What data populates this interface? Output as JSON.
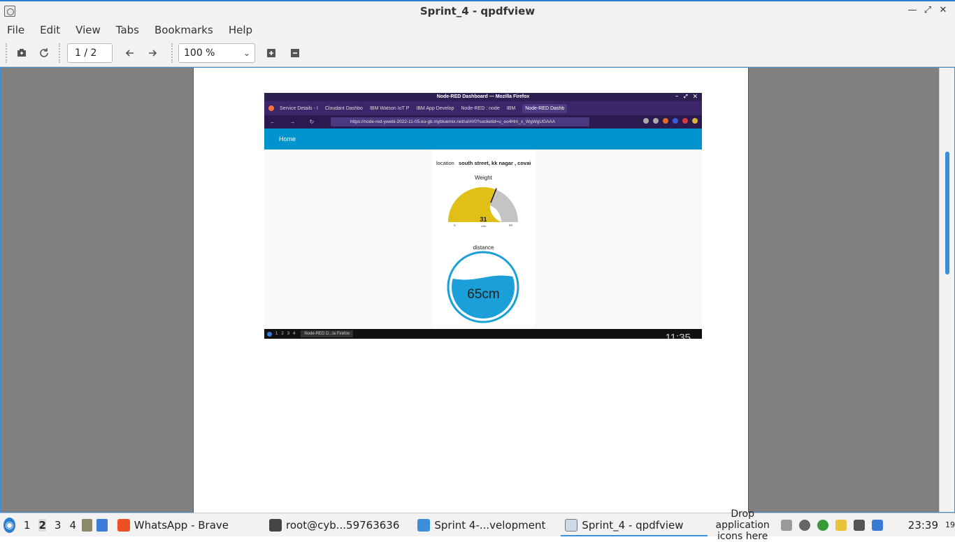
{
  "window": {
    "title": "Sprint_4 - qpdfview"
  },
  "menubar": {
    "items": [
      "File",
      "Edit",
      "View",
      "Tabs",
      "Bookmarks",
      "Help"
    ]
  },
  "toolbar": {
    "page_value": "1 / 2",
    "zoom_value": "100 %"
  },
  "embedded_screenshot": {
    "browser_title": "Node-RED Dashboard — Mozilla Firefox",
    "tabs": [
      "Service Details - I",
      "Cloudant Dashbo",
      "IBM Watson IoT P",
      "IBM App Develop",
      "Node-RED : node",
      "IBM",
      "Node-RED Dashb"
    ],
    "url": "https://node-red-ywebi-2022-11-05.eu-gb.mybluemix.net/ui/#!/0?socketid=u_eo4Hm_x_WgWgUGAAA",
    "header_nav": "Home",
    "location_label": "location",
    "location_value": "south street, kk nagar , covai",
    "gauge": {
      "label": "Weight",
      "value": "31",
      "units": "units",
      "min": "0",
      "max": "50",
      "value_fraction": 0.62
    },
    "tank": {
      "label": "distance",
      "value": "65cm",
      "fill_fraction": 0.65
    },
    "taskbar": {
      "workspaces": [
        "1",
        "2",
        "3",
        "4"
      ],
      "app": "Node-RED D...la Firefox",
      "clock": "11:35"
    }
  },
  "taskbar": {
    "workspaces": [
      "1",
      "2",
      "3",
      "4"
    ],
    "tasks": [
      "WhatsApp - Brave",
      "root@cyb...59763636",
      "Sprint 4-...velopment",
      "Sprint_4 - qpdfview"
    ],
    "drop_text": "Drop application icons here",
    "clock": "23:39",
    "date_small": "19"
  },
  "colors": {
    "accent": "#3a8fd8",
    "nodered_header": "#0094ce",
    "gauge_fill": "#e0bf17",
    "tank_water": "#1a9fd8"
  }
}
